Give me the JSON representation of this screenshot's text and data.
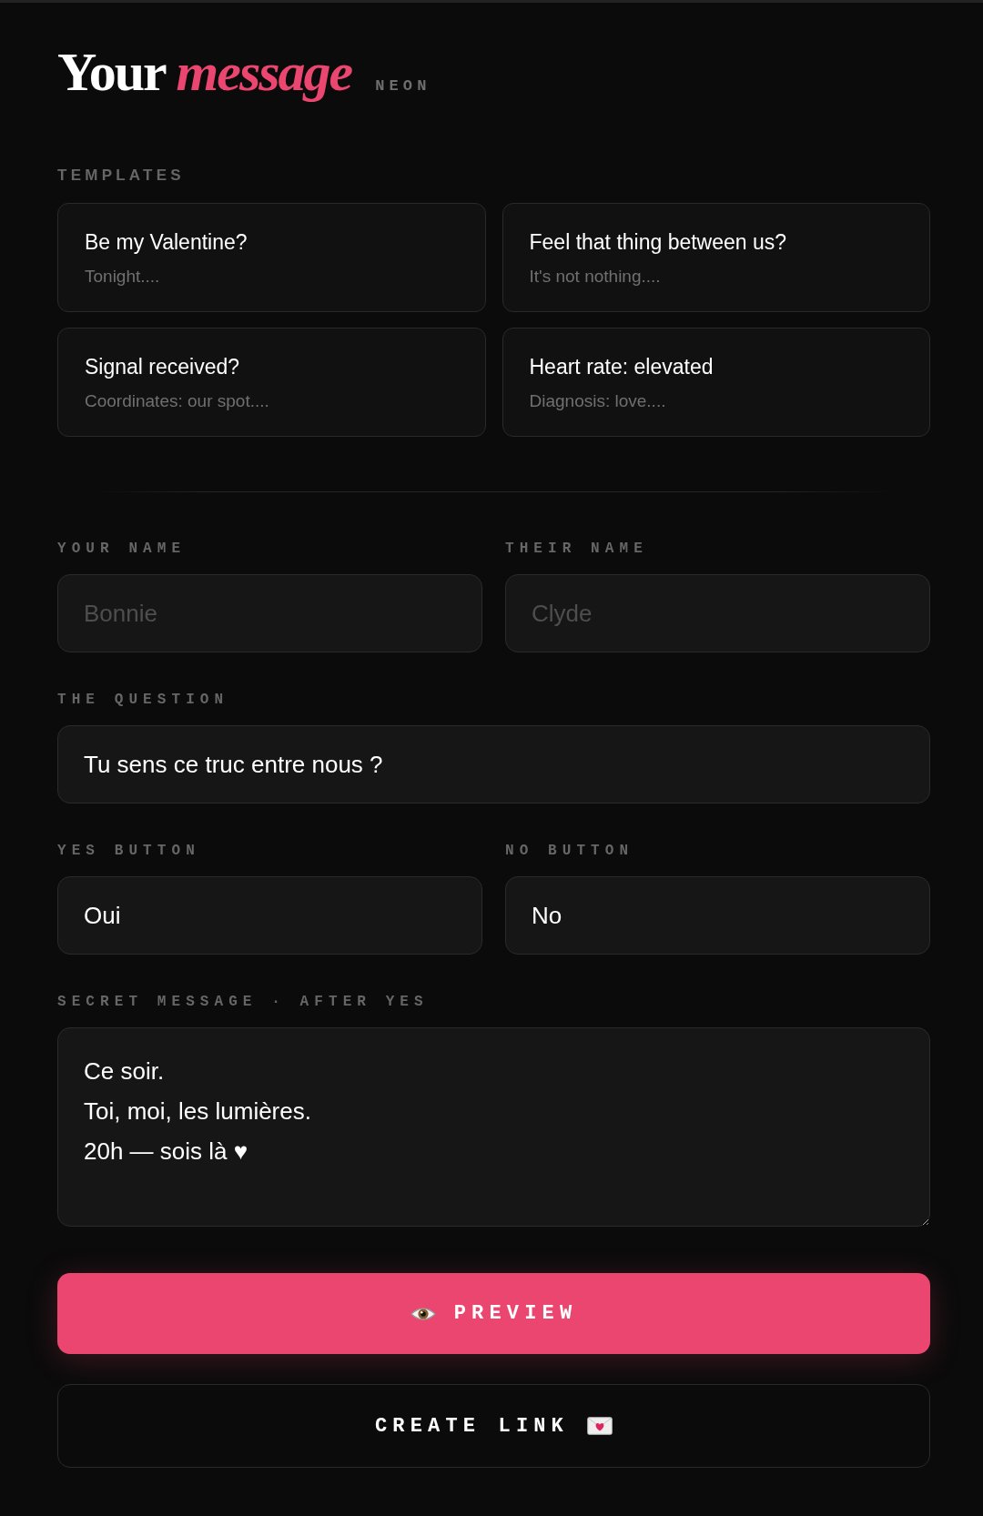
{
  "header": {
    "title": "Your *message*",
    "tag": "NEON"
  },
  "templates": {
    "label": "TEMPLATES",
    "items": [
      {
        "title": "Be my Valentine?",
        "preview": "Tonight...."
      },
      {
        "title": "Feel that thing between us?",
        "preview": "It's not nothing...."
      },
      {
        "title": "Signal received?",
        "preview": "Coordinates: our spot...."
      },
      {
        "title": "Heart rate: elevated",
        "preview": "Diagnosis: love...."
      }
    ]
  },
  "form": {
    "rows": [
      {
        "fields": [
          {
            "kind": "input",
            "label": "YOUR NAME",
            "placeholder": "Bonnie"
          },
          {
            "kind": "input",
            "label": "THEIR NAME",
            "placeholder": "Clyde"
          }
        ]
      },
      {
        "fields": [
          {
            "kind": "input",
            "label": "THE QUESTION",
            "value": "Tu sens ce truc entre nous ?"
          }
        ]
      },
      {
        "fields": [
          {
            "kind": "input",
            "label": "YES BUTTON",
            "value": "Oui"
          },
          {
            "kind": "input",
            "label": "NO BUTTON",
            "value": "No"
          }
        ]
      },
      {
        "fields": [
          {
            "kind": "textarea",
            "label": "SECRET MESSAGE · AFTER YES",
            "value": "Ce soir.\nToi, moi, les lumières.\n20h — sois là ♥"
          }
        ]
      }
    ]
  },
  "actions": [
    {
      "kind": "preview",
      "label": "PREVIEW"
    },
    {
      "kind": "create",
      "label": "CREATE LINK"
    }
  ]
}
